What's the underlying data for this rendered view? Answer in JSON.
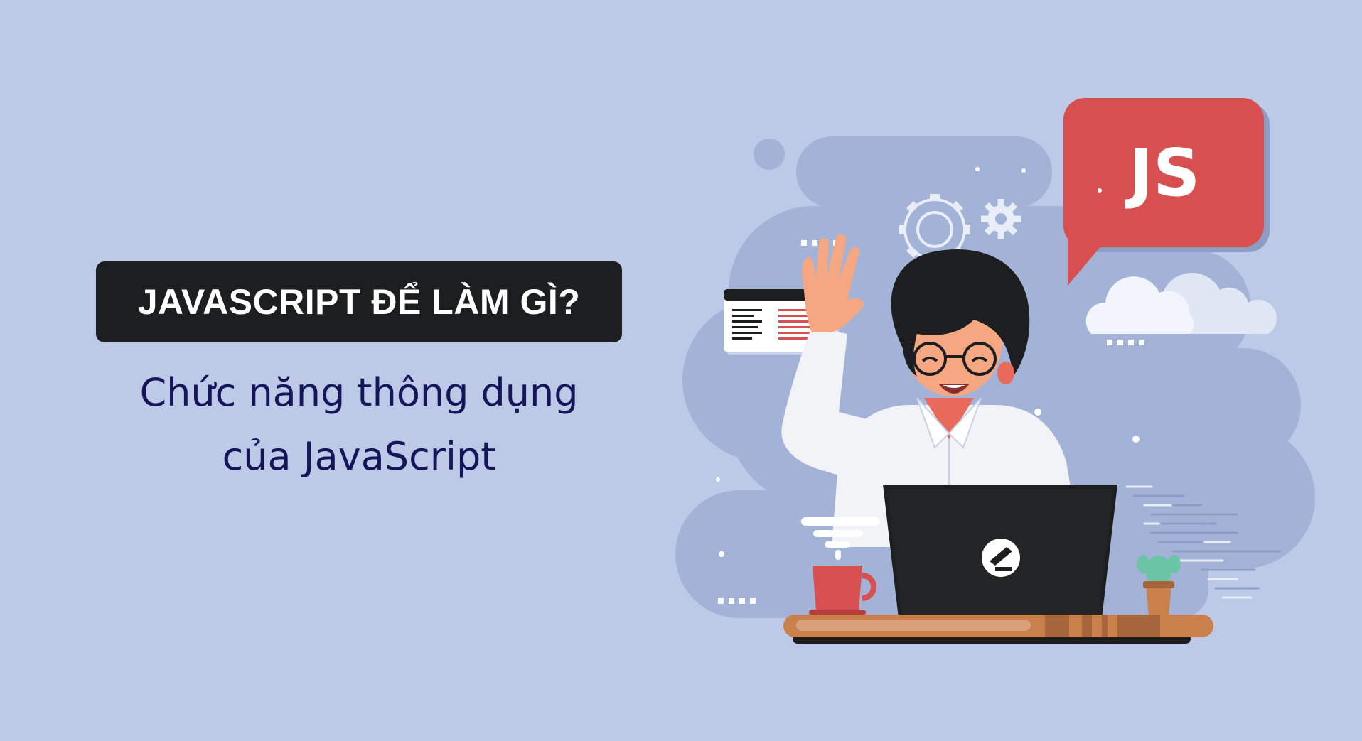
{
  "title": "JAVASCRIPT ĐỂ LÀM GÌ?",
  "subtitle_lines": [
    "Chức năng thông dụng",
    "của JavaScript"
  ],
  "bubble_text": "JS",
  "colors": {
    "background": "#bccae8",
    "title_badge": "#1d1e1f",
    "subtitle_text": "#16155a",
    "blob": "#a3b3d8",
    "js_bubble": "#d84f4f"
  },
  "icons": [
    "gear-icon",
    "small-gear-icon",
    "cloud-icon",
    "browser-window-icon",
    "coffee-cup-icon",
    "cactus-icon",
    "laptop-logo-icon"
  ]
}
